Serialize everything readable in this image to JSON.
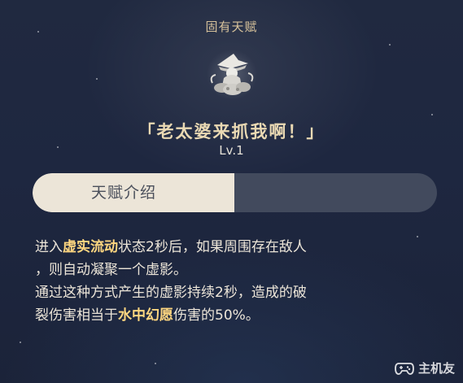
{
  "header": {
    "title": "固有天赋"
  },
  "talent": {
    "icon": "talent-emblem-icon",
    "name": "「老太婆来抓我啊！」",
    "level": "Lv.1"
  },
  "tabs": {
    "active_label": "天赋介绍",
    "inactive_label": ""
  },
  "description": {
    "line1": {
      "before": "进入",
      "highlight": "虚实流动",
      "after": "状态2秒后，如果周围存在敌人"
    },
    "line2": {
      "text": "，则自动凝聚一个虚影。"
    },
    "line3": {
      "text": "通过这种方式产生的虚影持续2秒，造成的破"
    },
    "line4": {
      "before": "裂伤害相当于",
      "highlight": "水中幻愿",
      "after": "伤害的50%。"
    }
  },
  "watermark": {
    "icon": "gamepad-logo-icon",
    "text": "主机友"
  },
  "colors": {
    "background": "#1e2740",
    "title_gold": "#d7c29b",
    "text": "#ece5d8",
    "highlight": "#ffd780",
    "tab_active": "#ece5d8",
    "tab_inactive": "#424a5d"
  }
}
